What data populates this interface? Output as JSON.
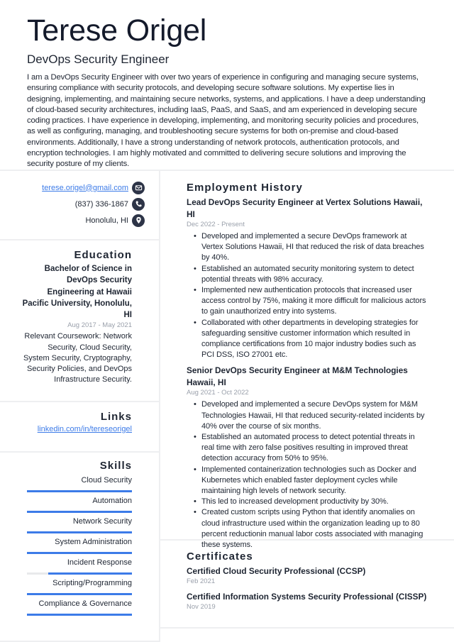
{
  "header": {
    "name": "Terese Origel",
    "title": "DevOps Security Engineer",
    "summary": "I am a DevOps Security Engineer with over two years of experience in configuring and managing secure systems, ensuring compliance with security protocols, and developing secure software solutions. My expertise lies in designing, implementing, and maintaining secure networks, systems, and applications. I have a deep understanding of cloud-based security architectures, including IaaS, PaaS, and SaaS, and am experienced in developing secure coding practices. I have experience in developing, implementing, and monitoring security policies and procedures, as well as configuring, managing, and troubleshooting secure systems for both on-premise and cloud-based environments. Additionally, I have a strong understanding of network protocols, authentication protocols, and encryption technologies. I am highly motivated and committed to delivering secure solutions and improving the security posture of my clients."
  },
  "contact": {
    "email": "terese.origel@gmail.com",
    "email_icon": "envelope-icon",
    "phone": "(837) 336-1867",
    "phone_icon": "phone-icon",
    "location": "Honolulu, HI",
    "location_icon": "map-pin-icon"
  },
  "education": {
    "title": "Education",
    "degree": "Bachelor of Science in DevOps Security Engineering at Hawaii Pacific University, Honolulu, HI",
    "dates": "Aug 2017 - May 2021",
    "description": "Relevant Coursework: Network Security, Cloud Security, System Security, Cryptography, Security Policies, and DevOps Infrastructure Security."
  },
  "links": {
    "title": "Links",
    "items": [
      "linkedin.com/in/tereseorigel"
    ]
  },
  "skills": {
    "title": "Skills",
    "accent_color": "#3c7be8",
    "items": [
      {
        "name": "Cloud Security",
        "level_percent": 100
      },
      {
        "name": "Automation",
        "level_percent": 100
      },
      {
        "name": "Network Security",
        "level_percent": 100
      },
      {
        "name": "System Administration",
        "level_percent": 100
      },
      {
        "name": "Incident Response",
        "level_percent": 80
      },
      {
        "name": "Scripting/Programming",
        "level_percent": 100
      },
      {
        "name": "Compliance & Governance",
        "level_percent": 100
      }
    ]
  },
  "employment": {
    "title": "Employment History",
    "jobs": [
      {
        "heading": "Lead DevOps Security Engineer at Vertex Solutions Hawaii, HI",
        "dates": "Dec 2022 - Present",
        "bullets": [
          "Developed and implemented a secure DevOps framework at Vertex Solutions Hawaii, HI that reduced the risk of data breaches by 40%.",
          "Established an automated security monitoring system to detect potential threats with 98% accuracy.",
          "Implemented new authentication protocols that increased user access control by 75%, making it more difficult for malicious actors to gain unauthorized entry into systems.",
          "Collaborated with other departments in developing strategies for safeguarding sensitive customer information which resulted in compliance certifications from 10 major industry bodies such as PCI DSS, ISO 27001 etc."
        ]
      },
      {
        "heading": "Senior DevOps Security Engineer at M&M Technologies Hawaii, HI",
        "dates": "Aug 2021 - Oct 2022",
        "bullets": [
          "Developed and implemented a secure DevOps system for M&M Technologies Hawaii, HI that reduced security-related incidents by 40% over the course of six months.",
          "Established an automated process to detect potential threats in real time with zero false positives resulting in improved threat detection accuracy from 50% to 95%.",
          "Implemented containerization technologies such as Docker and Kubernetes which enabled faster deployment cycles while maintaining high levels of network security.",
          "This led to increased development productivity by 30%.",
          "Created custom scripts using Python that identify anomalies on cloud infrastructure used within the organization leading up to 80 percent reductionin manual labor costs associated with managing these systems."
        ]
      }
    ]
  },
  "certificates": {
    "title": "Certificates",
    "items": [
      {
        "name": "Certified Cloud Security Professional (CCSP)",
        "date": "Feb 2021"
      },
      {
        "name": "Certified Information Systems Security Professional (CISSP)",
        "date": "Nov 2019"
      }
    ]
  }
}
